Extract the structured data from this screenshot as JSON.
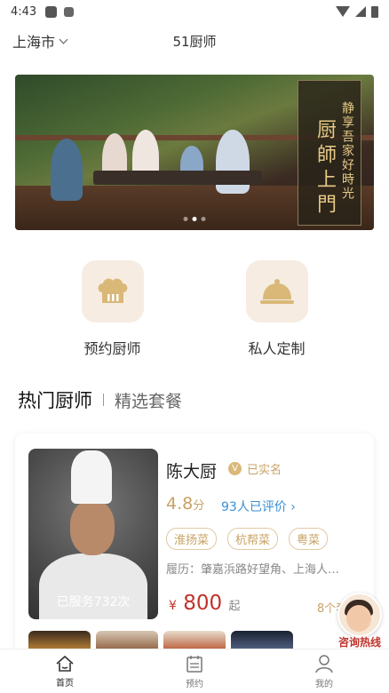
{
  "status_bar": {
    "time": "4:43"
  },
  "header": {
    "city": "上海市",
    "app_title": "51厨师"
  },
  "banner": {
    "slogan_main": "厨師上門",
    "slogan_sub": "静享吾家好時光",
    "slide_count": 3,
    "active_slide": 2
  },
  "services": [
    {
      "label": "预约厨师",
      "icon": "chef-hat-icon"
    },
    {
      "label": "私人定制",
      "icon": "cloche-icon"
    }
  ],
  "tabs": {
    "active": "热门厨师",
    "other": "精选套餐"
  },
  "chef_card": {
    "name": "陈大厨",
    "verified_badge": "V",
    "verified_label": "已实名",
    "rating": "4.8",
    "rating_unit": "分",
    "reviews": "93人已评价",
    "tags": [
      "淮扬菜",
      "杭帮菜",
      "粤菜"
    ],
    "history": "履历：肇嘉浜路好望角、上海人…",
    "served": "已服务732次",
    "price_currency": "¥",
    "price_value": "800",
    "price_unit": "起",
    "packages": "8个套"
  },
  "hotline": {
    "label": "咨询热线"
  },
  "bottom_nav": [
    {
      "label": "首页",
      "icon": "home-icon",
      "active": true
    },
    {
      "label": "预约",
      "icon": "calendar-icon",
      "active": false
    },
    {
      "label": "我的",
      "icon": "user-icon",
      "active": false
    }
  ],
  "colors": {
    "accent_gold": "#c8a265",
    "price_red": "#c0332b",
    "link_blue": "#3b8fd6",
    "icon_bg": "#f6ece1"
  }
}
